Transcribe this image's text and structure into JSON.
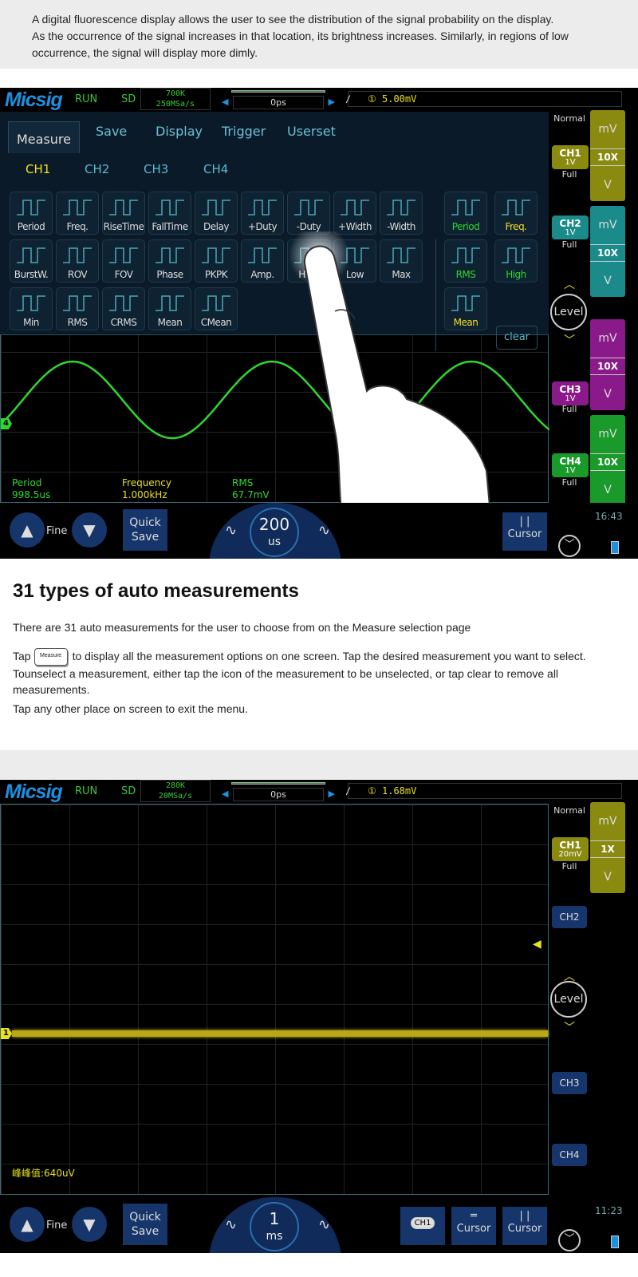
{
  "intro": {
    "lines": [
      "A digital fluorescence display allows the user to see the distribution of the signal probability on the display.",
      "As the occurrence of the signal increases in that location, its brightness increases.  Similarly, in regions of low",
      "occurrence, the signal will display more dimly."
    ]
  },
  "scope1": {
    "logo": "Micsig",
    "run": "RUN",
    "sd": "SD",
    "memory": "700K",
    "sample_rate": "250MSa/s",
    "offset": "0ps",
    "trigger_value": "5.00mV",
    "trigger_channel": "①",
    "tabs": [
      "Measure",
      "Save",
      "Display",
      "Trigger",
      "Userset"
    ],
    "channels": [
      "CH1",
      "CH2",
      "CH3",
      "CH4"
    ],
    "measure_rows": [
      [
        "Period",
        "Freq.",
        "RiseTime",
        "FallTime",
        "Delay",
        "+Duty",
        "-Duty",
        "+Width",
        "-Width"
      ],
      [
        "BurstW.",
        "ROV",
        "FOV",
        "Phase",
        "PKPK",
        "Amp.",
        "High",
        "Low",
        "Max"
      ],
      [
        "Min",
        "RMS",
        "CRMS",
        "Mean",
        "CMean"
      ]
    ],
    "selected": [
      [
        "Period",
        "Freq."
      ],
      [
        "RMS",
        "High"
      ],
      [
        "Mean"
      ]
    ],
    "clear": "clear",
    "readouts": [
      {
        "label": "Period",
        "value": "998.5us"
      },
      {
        "label": "Frequency",
        "value": "1.000kHz"
      },
      {
        "label": "RMS",
        "value": "67.7mV"
      }
    ],
    "mode": "Normal",
    "ch_panel": [
      {
        "name": "CH1",
        "scale": "1V",
        "bw": "Full",
        "color": "#8a8a10"
      },
      {
        "name": "CH2",
        "scale": "1V",
        "bw": "Full",
        "color": "#1a8a8a"
      },
      {
        "name": "CH3",
        "scale": "1V",
        "bw": "Full",
        "color": "#8a1a8a"
      },
      {
        "name": "CH4",
        "scale": "1V",
        "bw": "Full",
        "color": "#1a9a2a"
      }
    ],
    "columns": [
      {
        "u": "mV",
        "x": "10X",
        "d": "V",
        "color": "#8a8a10"
      },
      {
        "u": "mV",
        "x": "10X",
        "d": "V",
        "color": "#1a8a8a"
      },
      {
        "u": "mV",
        "x": "10X",
        "d": "V",
        "color": "#8a1a8a"
      },
      {
        "u": "mV",
        "x": "10X",
        "d": "V",
        "color": "#1a9a2a"
      }
    ],
    "level": "Level",
    "marker": "4",
    "trace_color": "#2ed82e",
    "fine": "Fine",
    "quick": "Quick",
    "save": "Save",
    "timebase_value": "200",
    "timebase_unit": "us",
    "cursor": "Cursor",
    "clock": "16:43"
  },
  "heading": "31 types of auto measurements",
  "para1": "There are 31 auto measurements for the user to choose from on the Measure selection page",
  "para2_tap": "Tap",
  "para2_icon": "Measure",
  "para2": "to display all the measurement options on one screen. Tap the desired measurement you want to select.  Tounselect a measurement, either tap the icon of the measurement to be unselected, or tap clear to remove all measurements.",
  "para3": "Tap any other place on screen to exit the menu.",
  "scope2": {
    "logo": "Micsig",
    "run": "RUN",
    "sd": "SD",
    "memory": "280K",
    "sample_rate": "20MSa/s",
    "offset": "0ps",
    "trigger_value": "1.68mV",
    "trigger_channel": "①",
    "mode": "Normal",
    "ch1": {
      "name": "CH1",
      "scale": "20mV",
      "bw": "Full"
    },
    "column": {
      "u": "mV",
      "x": "1X",
      "d": "V",
      "color": "#8a8a10"
    },
    "ch2": "CH2",
    "ch3": "CH3",
    "ch4": "CH4",
    "level": "Level",
    "marker": "1",
    "trace_color": "#d8c820",
    "readout": "峰峰值:640uV",
    "fine": "Fine",
    "quick": "Quick",
    "save": "Save",
    "timebase_value": "1",
    "timebase_unit": "ms",
    "ch1_btn": "CH1",
    "cursor_h": "Cursor",
    "cursor_v": "Cursor",
    "clock": "11:23"
  }
}
